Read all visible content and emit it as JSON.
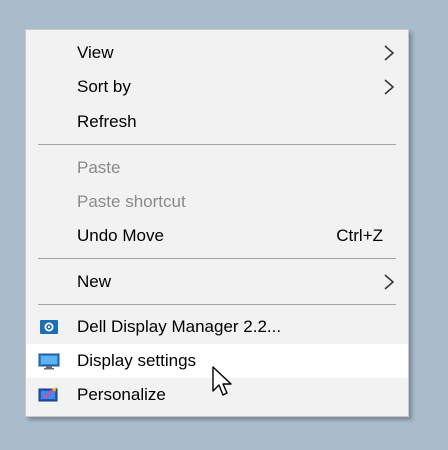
{
  "menu": {
    "items": [
      {
        "label": "View",
        "submenu": true
      },
      {
        "label": "Sort by",
        "submenu": true
      },
      {
        "label": "Refresh"
      },
      {
        "label": "Paste",
        "disabled": true
      },
      {
        "label": "Paste shortcut",
        "disabled": true
      },
      {
        "label": "Undo Move",
        "shortcut": "Ctrl+Z"
      },
      {
        "label": "New",
        "submenu": true
      },
      {
        "label": "Dell Display Manager 2.2...",
        "icon": "dell-display-manager-icon"
      },
      {
        "label": "Display settings",
        "icon": "display-settings-icon",
        "hovered": true
      },
      {
        "label": "Personalize",
        "icon": "personalize-icon"
      }
    ]
  },
  "colors": {
    "desktop": "#a9bccb",
    "menu_background": "#f2f2f2",
    "hover_background": "#ffffff",
    "disabled_text": "#8a8a8a",
    "separator": "#a5a5a5"
  }
}
